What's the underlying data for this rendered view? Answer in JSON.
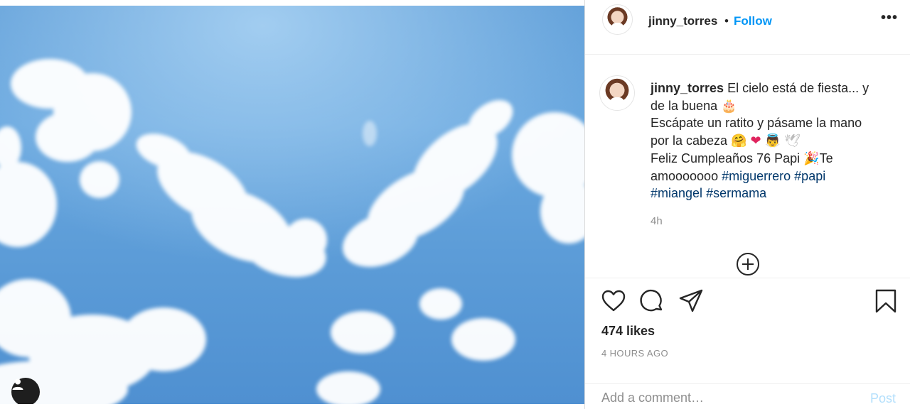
{
  "post": {
    "author": "jinny_torres",
    "dot": "•",
    "follow_label": "Follow",
    "more_label": "•••",
    "caption": {
      "line1": "El cielo está de fiesta... y",
      "line2": "de la buena",
      "line3": "Escápate un ratito y pásame la mano",
      "line4": "por la cabeza",
      "line5": "Feliz Cumpleaños 76 Papi",
      "line5b": "Te",
      "line6": "amooooooo",
      "hashtags": [
        "#miguerrero",
        "#papi",
        "#miangel",
        "#sermama"
      ]
    },
    "relative_time": "4h",
    "likes": "474 likes",
    "posted_ago": "4 HOURS AGO"
  },
  "comment": {
    "placeholder": "Add a comment…",
    "post_label": "Post"
  },
  "icons": {
    "like": "heart-icon",
    "comment": "comment-icon",
    "share": "paper-plane-icon",
    "save": "bookmark-icon",
    "load_more": "plus-circle-icon",
    "user_tags": "user-icon"
  },
  "colors": {
    "follow": "#0095f6",
    "hashtag": "#00376b",
    "post_disabled": "#b2dffc",
    "sky": "#5f9ed8"
  }
}
